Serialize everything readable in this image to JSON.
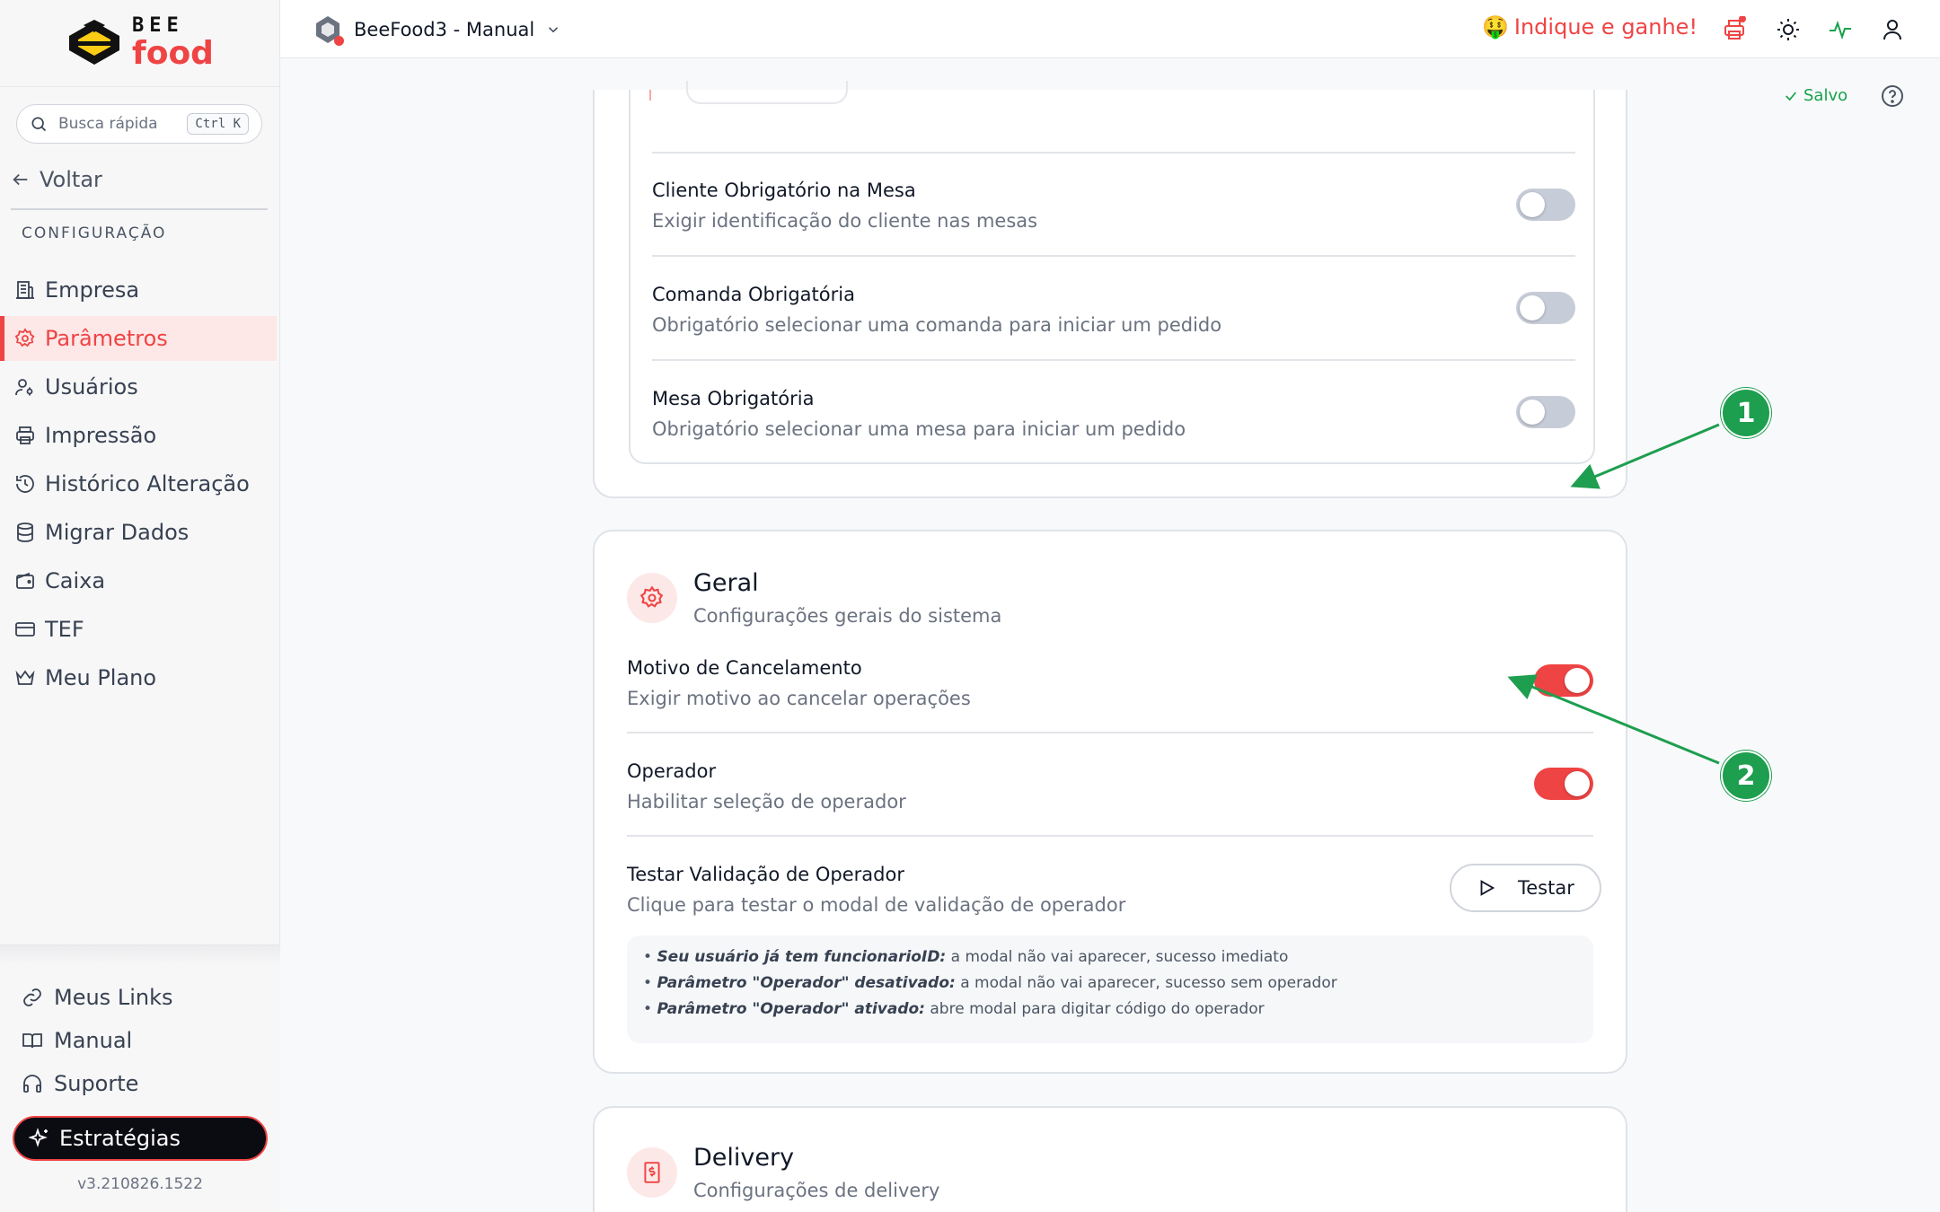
{
  "brand": {
    "bee": "BEE",
    "food": "food"
  },
  "search": {
    "placeholder": "Busca rápida",
    "shortcut": "Ctrl K"
  },
  "sidebar": {
    "back_label": "Voltar",
    "section_title": "CONFIGURAÇÃO",
    "items": [
      {
        "label": "Empresa",
        "icon": "building-icon"
      },
      {
        "label": "Parâmetros",
        "icon": "gear-icon",
        "active": true
      },
      {
        "label": "Usuários",
        "icon": "user-gear-icon"
      },
      {
        "label": "Impressão",
        "icon": "printer-icon"
      },
      {
        "label": "Histórico Alteração",
        "icon": "history-icon"
      },
      {
        "label": "Migrar Dados",
        "icon": "database-icon"
      },
      {
        "label": "Caixa",
        "icon": "wallet-icon"
      },
      {
        "label": "TEF",
        "icon": "credit-card-icon"
      },
      {
        "label": "Meu Plano",
        "icon": "crown-icon"
      }
    ],
    "bottom_items": [
      {
        "label": "Meus Links",
        "icon": "link-icon"
      },
      {
        "label": "Manual",
        "icon": "book-icon"
      },
      {
        "label": "Suporte",
        "icon": "headset-icon"
      }
    ],
    "strategies_label": "Estratégias",
    "version": "v3.210826.1522"
  },
  "topbar": {
    "app_title": "BeeFood3 - Manual",
    "promo": "Indique e ganhe!",
    "promo_emoji": "🤑"
  },
  "status": {
    "saved": "Salvo"
  },
  "mesas_card": {
    "rows": [
      {
        "title": "Cliente Obrigatório na Mesa",
        "desc": "Exigir identificação do cliente nas mesas",
        "enabled": false
      },
      {
        "title": "Comanda Obrigatória",
        "desc": "Obrigatório selecionar uma comanda para iniciar um pedido",
        "enabled": false
      },
      {
        "title": "Mesa Obrigatória",
        "desc": "Obrigatório selecionar uma mesa para iniciar um pedido",
        "enabled": false
      }
    ]
  },
  "geral_card": {
    "title": "Geral",
    "subtitle": "Configurações gerais do sistema",
    "rows": [
      {
        "title": "Motivo de Cancelamento",
        "desc": "Exigir motivo ao cancelar operações",
        "enabled": true
      },
      {
        "title": "Operador",
        "desc": "Habilitar seleção de operador",
        "enabled": true
      },
      {
        "title": "Testar Validação de Operador",
        "desc": "Clique para testar o modal de validação de operador"
      }
    ],
    "test_button": "Testar",
    "info": [
      {
        "bold": "Seu usuário já tem funcionarioID:",
        "text": " a modal não vai aparecer, sucesso imediato"
      },
      {
        "bold": "Parâmetro \"Operador\" desativado:",
        "text": " a modal não vai aparecer, sucesso sem operador"
      },
      {
        "bold": "Parâmetro \"Operador\" ativado:",
        "text": " abre modal para digitar código do operador"
      }
    ]
  },
  "delivery_card": {
    "title": "Delivery",
    "subtitle": "Configurações de delivery"
  },
  "annotations": [
    "1",
    "2"
  ],
  "colors": {
    "accent": "#ef4444",
    "annotation": "#1e9e4f",
    "toggle_off": "#c7cdd8"
  }
}
